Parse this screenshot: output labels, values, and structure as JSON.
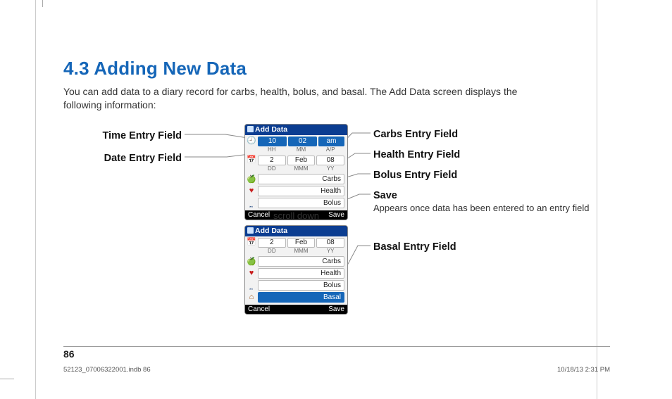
{
  "heading": "4.3 Adding New Data",
  "intro": "You can add data to a diary record for carbs, health, bolus, and basal. The Add Data screen displays the following information:",
  "callouts": {
    "time": "Time Entry Field",
    "date": "Date Entry Field",
    "carbs": "Carbs Entry Field",
    "health": "Health Entry Field",
    "bolus": "Bolus Entry Field",
    "save": "Save",
    "save_note": "Appears once data has been entered to an entry field",
    "basal": "Basal Entry Field"
  },
  "scroll_label": "scroll down",
  "device": {
    "title": "Add Data",
    "time": {
      "hh": "10",
      "mm": "02",
      "ap": "am",
      "sub": [
        "HH",
        "MM",
        "A/P"
      ]
    },
    "date": {
      "dd": "2",
      "mmm": "Feb",
      "yy": "08",
      "sub": [
        "DD",
        "MMM",
        "YY"
      ]
    },
    "fields": {
      "carbs": "Carbs",
      "health": "Health",
      "bolus": "Bolus",
      "basal": "Basal"
    },
    "foot": {
      "left": "Cancel",
      "right": "Save"
    }
  },
  "page_number": "86",
  "printmark": {
    "file": "52123_07006322001.indb   86",
    "stamp": "10/18/13   2:31 PM"
  }
}
